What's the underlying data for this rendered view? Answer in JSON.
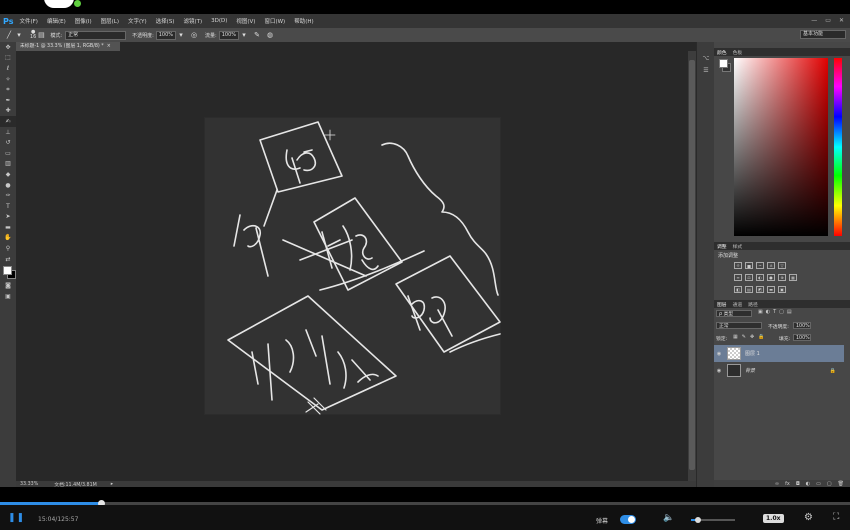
{
  "player": {
    "time": "15:04/125:57",
    "danmu_label": "弹幕",
    "speed": "1.0x",
    "play_icon": "pause-icon",
    "progress_fraction": 0.12,
    "volume_fraction": 0.15
  },
  "menubar": {
    "logo": "Ps",
    "items": [
      "文件(F)",
      "编辑(E)",
      "图像(I)",
      "图层(L)",
      "文字(Y)",
      "选择(S)",
      "滤镜(T)",
      "3D(D)",
      "视图(V)",
      "窗口(W)",
      "帮助(H)"
    ],
    "window_controls": [
      "—",
      "▭",
      "✕"
    ]
  },
  "options": {
    "brush_size": "16",
    "mode_label": "模式:",
    "mode_value": "正常",
    "opacity_label": "不透明度:",
    "opacity_value": "100%",
    "flow_label": "流量:",
    "flow_value": "100%",
    "workspace": "基本功能"
  },
  "document": {
    "tab_title": "未标题-1 @ 33.3% (图层 1, RGB/8) *",
    "tab_close": "×",
    "zoom": "33.33%",
    "doc_info": "文档:11.4M/3.81M"
  },
  "color_panel": {
    "tabs": [
      "颜色",
      "色板"
    ]
  },
  "adjust_panel": {
    "tabs": [
      "调整",
      "样式"
    ],
    "title": "添加调整"
  },
  "layers_panel": {
    "tabs": [
      "图层",
      "通道",
      "路径"
    ],
    "filter": "ρ 类型",
    "blend_mode": "正常",
    "opacity_label": "不透明度:",
    "opacity_value": "100%",
    "lock_label": "锁定:",
    "fill_label": "填充:",
    "fill_value": "100%",
    "layers": [
      {
        "name": "图层 1"
      },
      {
        "name": "背景"
      }
    ]
  },
  "colors": {
    "accent": "#2e8de6",
    "selected_layer": "#6b7d96"
  }
}
